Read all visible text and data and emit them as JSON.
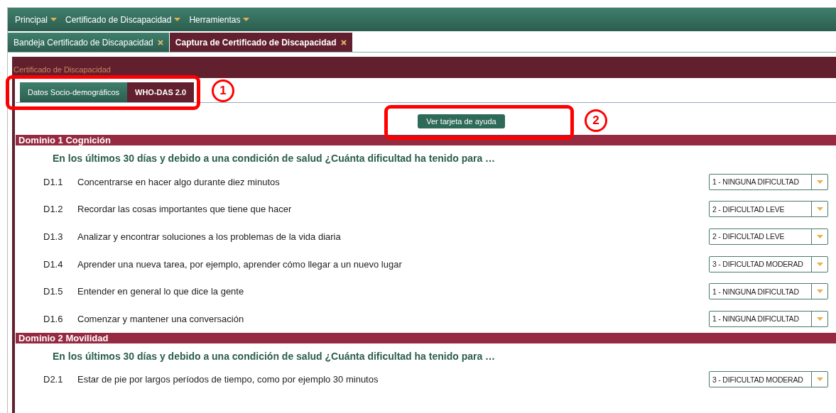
{
  "menu": [
    {
      "label": "Principal"
    },
    {
      "label": "Certificado de Discapacidad"
    },
    {
      "label": "Herramientas"
    }
  ],
  "doc_tabs": [
    {
      "label": "Bandeja Certificado de Discapacidad",
      "selected": false
    },
    {
      "label": "Captura de Certificado de Discapacidad",
      "selected": true
    }
  ],
  "panel_title": "Certificado de Discapacidad",
  "tabs": [
    {
      "label": "Datos Socio-demográficos",
      "selected": false
    },
    {
      "label": "WHO-DAS 2.0",
      "selected": true
    }
  ],
  "help_button": "Ver tarjeta de ayuda",
  "annotations": [
    {
      "label": "1"
    },
    {
      "label": "2"
    }
  ],
  "domains": [
    {
      "title": "Dominio 1 Cognición",
      "question": "En los últimos 30 días y debido a una condición de salud ¿Cuánta dificultad ha tenido para …",
      "items": [
        {
          "code": "D1.1",
          "text": "Concentrarse en hacer algo durante diez minutos",
          "value": "1 - NINGUNA DIFICULTAD"
        },
        {
          "code": "D1.2",
          "text": "Recordar las cosas importantes que tiene que hacer",
          "value": "2 - DIFICULTAD LEVE"
        },
        {
          "code": "D1.3",
          "text": "Analizar y encontrar soluciones a los problemas de la vida diaria",
          "value": "2 - DIFICULTAD LEVE"
        },
        {
          "code": "D1.4",
          "text": "Aprender una nueva tarea, por ejemplo, aprender cómo llegar a un nuevo lugar",
          "value": "3 - DIFICULTAD MODERAD"
        },
        {
          "code": "D1.5",
          "text": "Entender en general lo que dice la gente",
          "value": "1 - NINGUNA DIFICULTAD"
        },
        {
          "code": "D1.6",
          "text": "Comenzar y mantener una conversación",
          "value": "1 - NINGUNA DIFICULTAD"
        }
      ]
    },
    {
      "title": "Dominio 2 Movilidad",
      "question": "En los últimos 30 días y debido a una condición de salud ¿Cuánta dificultad ha tenido para …",
      "items": [
        {
          "code": "D2.1",
          "text": "Estar de pie por largos períodos de tiempo, como por ejemplo 30 minutos",
          "value": "3 - DIFICULTAD MODERAD"
        }
      ]
    }
  ]
}
